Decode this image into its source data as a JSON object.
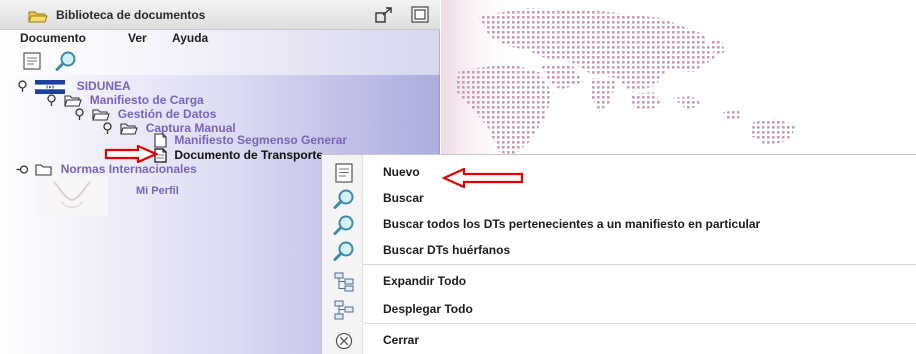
{
  "window": {
    "title": "Biblioteca de documentos"
  },
  "menubar": {
    "items": [
      "Documento",
      "Ver",
      "Ayuda"
    ]
  },
  "tree": {
    "root": "SIDUNEA",
    "manifiesto_carga": "Manifiesto de Carga",
    "gestion_datos": "Gestión de Datos",
    "captura_manual": "Captura Manual",
    "manifiesto_segmenso": "Manifiesto Segmenso Generar",
    "documento_transporte": "Documento de Transporte",
    "normas": "Normas Internacionales"
  },
  "profile": {
    "label": "Mi Perfil"
  },
  "context_menu": {
    "items": [
      {
        "label": "Nuevo",
        "icon": "new-document-icon"
      },
      {
        "label": "Buscar",
        "icon": "search-icon"
      },
      {
        "label": "Buscar todos los DTs pertenecientes a un manifiesto en particular",
        "icon": "search-icon"
      },
      {
        "label": "Buscar DTs huérfanos",
        "icon": "search-icon"
      },
      {
        "label": "Expandir Todo",
        "icon": "expand-tree-icon"
      },
      {
        "label": "Desplegar Todo",
        "icon": "collapse-tree-icon"
      },
      {
        "label": "Cerrar",
        "icon": "close-icon"
      }
    ]
  },
  "colors": {
    "arrow": "#e00000",
    "tree_link": "#7a64b8",
    "map_dots": "#c99ab6"
  }
}
